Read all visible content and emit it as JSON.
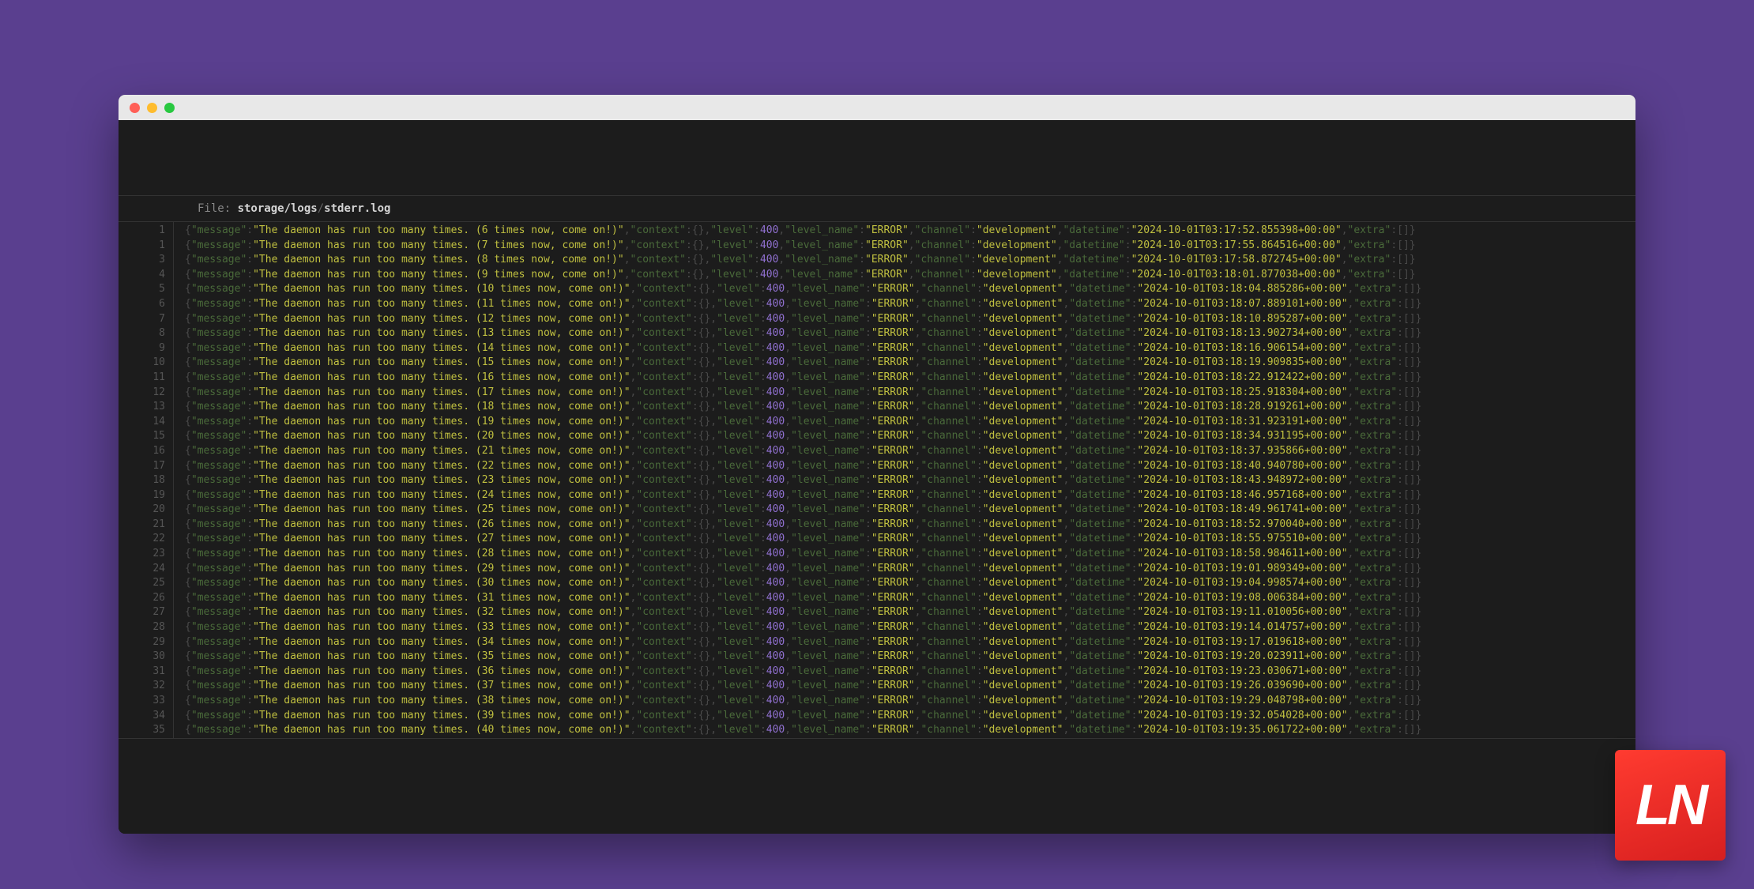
{
  "file_label": "File: ",
  "path_segment_1": "storage/logs",
  "path_separator": "/",
  "path_segment_2": "stderr.log",
  "logo_text": "LN",
  "log_template": {
    "key_message": "\"message\"",
    "key_context": "\"context\"",
    "key_level": "\"level\"",
    "key_level_name": "\"level_name\"",
    "key_channel": "\"channel\"",
    "key_datetime": "\"datetime\"",
    "key_extra": "\"extra\"",
    "level_value": "400",
    "level_name_value": "\"ERROR\"",
    "channel_value": "\"development\"",
    "empty_obj": "{}",
    "empty_arr": "[]"
  },
  "log_rows": [
    {
      "n": 1,
      "msg": "\"The daemon has run too many times. (6 times now, come on!)\"",
      "dt": "\"2024-10-01T03:17:52.855398+00:00\""
    },
    {
      "n": 1,
      "msg": "\"The daemon has run too many times. (7 times now, come on!)\"",
      "dt": "\"2024-10-01T03:17:55.864516+00:00\""
    },
    {
      "n": 3,
      "msg": "\"The daemon has run too many times. (8 times now, come on!)\"",
      "dt": "\"2024-10-01T03:17:58.872745+00:00\""
    },
    {
      "n": 4,
      "msg": "\"The daemon has run too many times. (9 times now, come on!)\"",
      "dt": "\"2024-10-01T03:18:01.877038+00:00\""
    },
    {
      "n": 5,
      "msg": "\"The daemon has run too many times. (10 times now, come on!)\"",
      "dt": "\"2024-10-01T03:18:04.885286+00:00\""
    },
    {
      "n": 6,
      "msg": "\"The daemon has run too many times. (11 times now, come on!)\"",
      "dt": "\"2024-10-01T03:18:07.889101+00:00\""
    },
    {
      "n": 7,
      "msg": "\"The daemon has run too many times. (12 times now, come on!)\"",
      "dt": "\"2024-10-01T03:18:10.895287+00:00\""
    },
    {
      "n": 8,
      "msg": "\"The daemon has run too many times. (13 times now, come on!)\"",
      "dt": "\"2024-10-01T03:18:13.902734+00:00\""
    },
    {
      "n": 9,
      "msg": "\"The daemon has run too many times. (14 times now, come on!)\"",
      "dt": "\"2024-10-01T03:18:16.906154+00:00\""
    },
    {
      "n": 10,
      "msg": "\"The daemon has run too many times. (15 times now, come on!)\"",
      "dt": "\"2024-10-01T03:18:19.909835+00:00\""
    },
    {
      "n": 11,
      "msg": "\"The daemon has run too many times. (16 times now, come on!)\"",
      "dt": "\"2024-10-01T03:18:22.912422+00:00\""
    },
    {
      "n": 12,
      "msg": "\"The daemon has run too many times. (17 times now, come on!)\"",
      "dt": "\"2024-10-01T03:18:25.918304+00:00\""
    },
    {
      "n": 13,
      "msg": "\"The daemon has run too many times. (18 times now, come on!)\"",
      "dt": "\"2024-10-01T03:18:28.919261+00:00\""
    },
    {
      "n": 14,
      "msg": "\"The daemon has run too many times. (19 times now, come on!)\"",
      "dt": "\"2024-10-01T03:18:31.923191+00:00\""
    },
    {
      "n": 15,
      "msg": "\"The daemon has run too many times. (20 times now, come on!)\"",
      "dt": "\"2024-10-01T03:18:34.931195+00:00\""
    },
    {
      "n": 16,
      "msg": "\"The daemon has run too many times. (21 times now, come on!)\"",
      "dt": "\"2024-10-01T03:18:37.935866+00:00\""
    },
    {
      "n": 17,
      "msg": "\"The daemon has run too many times. (22 times now, come on!)\"",
      "dt": "\"2024-10-01T03:18:40.940780+00:00\""
    },
    {
      "n": 18,
      "msg": "\"The daemon has run too many times. (23 times now, come on!)\"",
      "dt": "\"2024-10-01T03:18:43.948972+00:00\""
    },
    {
      "n": 19,
      "msg": "\"The daemon has run too many times. (24 times now, come on!)\"",
      "dt": "\"2024-10-01T03:18:46.957168+00:00\""
    },
    {
      "n": 20,
      "msg": "\"The daemon has run too many times. (25 times now, come on!)\"",
      "dt": "\"2024-10-01T03:18:49.961741+00:00\""
    },
    {
      "n": 21,
      "msg": "\"The daemon has run too many times. (26 times now, come on!)\"",
      "dt": "\"2024-10-01T03:18:52.970040+00:00\""
    },
    {
      "n": 22,
      "msg": "\"The daemon has run too many times. (27 times now, come on!)\"",
      "dt": "\"2024-10-01T03:18:55.975510+00:00\""
    },
    {
      "n": 23,
      "msg": "\"The daemon has run too many times. (28 times now, come on!)\"",
      "dt": "\"2024-10-01T03:18:58.984611+00:00\""
    },
    {
      "n": 24,
      "msg": "\"The daemon has run too many times. (29 times now, come on!)\"",
      "dt": "\"2024-10-01T03:19:01.989349+00:00\""
    },
    {
      "n": 25,
      "msg": "\"The daemon has run too many times. (30 times now, come on!)\"",
      "dt": "\"2024-10-01T03:19:04.998574+00:00\""
    },
    {
      "n": 26,
      "msg": "\"The daemon has run too many times. (31 times now, come on!)\"",
      "dt": "\"2024-10-01T03:19:08.006384+00:00\""
    },
    {
      "n": 27,
      "msg": "\"The daemon has run too many times. (32 times now, come on!)\"",
      "dt": "\"2024-10-01T03:19:11.010056+00:00\""
    },
    {
      "n": 28,
      "msg": "\"The daemon has run too many times. (33 times now, come on!)\"",
      "dt": "\"2024-10-01T03:19:14.014757+00:00\""
    },
    {
      "n": 29,
      "msg": "\"The daemon has run too many times. (34 times now, come on!)\"",
      "dt": "\"2024-10-01T03:19:17.019618+00:00\""
    },
    {
      "n": 30,
      "msg": "\"The daemon has run too many times. (35 times now, come on!)\"",
      "dt": "\"2024-10-01T03:19:20.023911+00:00\""
    },
    {
      "n": 31,
      "msg": "\"The daemon has run too many times. (36 times now, come on!)\"",
      "dt": "\"2024-10-01T03:19:23.030671+00:00\""
    },
    {
      "n": 32,
      "msg": "\"The daemon has run too many times. (37 times now, come on!)\"",
      "dt": "\"2024-10-01T03:19:26.039690+00:00\""
    },
    {
      "n": 33,
      "msg": "\"The daemon has run too many times. (38 times now, come on!)\"",
      "dt": "\"2024-10-01T03:19:29.048798+00:00\""
    },
    {
      "n": 34,
      "msg": "\"The daemon has run too many times. (39 times now, come on!)\"",
      "dt": "\"2024-10-01T03:19:32.054028+00:00\""
    },
    {
      "n": 35,
      "msg": "\"The daemon has run too many times. (40 times now, come on!)\"",
      "dt": "\"2024-10-01T03:19:35.061722+00:00\""
    }
  ]
}
